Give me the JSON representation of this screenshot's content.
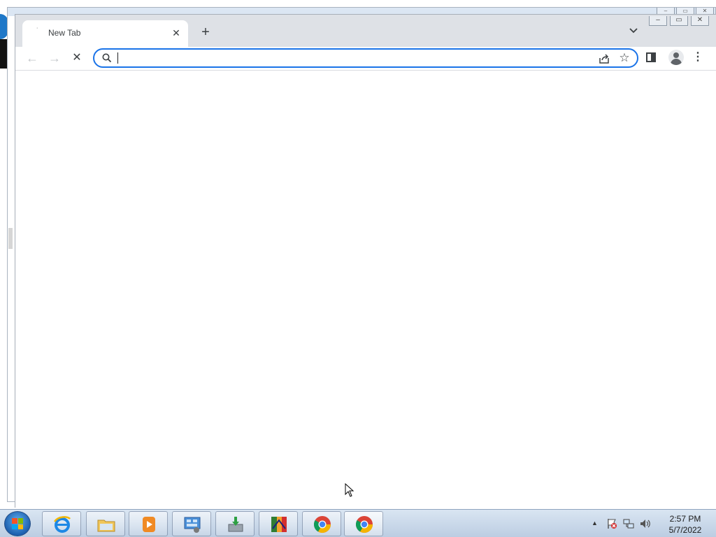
{
  "browser": {
    "tab": {
      "title": "New Tab",
      "favicon": "loading-dot",
      "close_label": "✕"
    },
    "new_tab_label": "+",
    "tab_search_label": "⌄",
    "window_controls": {
      "minimize": "–",
      "maximize": "▭",
      "close": "✕"
    },
    "toolbar": {
      "back_label": "←",
      "forward_label": "→",
      "stop_label": "✕",
      "star_label": "☆",
      "menu_label": "⋮"
    },
    "omnibox": {
      "value": "",
      "placeholder": ""
    }
  },
  "background_window": {
    "controls": {
      "minimize": "–",
      "maximize": "▭",
      "close": "✕"
    }
  },
  "taskbar": {
    "apps": [
      {
        "name": "Internet Explorer",
        "icon": "ie-icon"
      },
      {
        "name": "Windows Explorer",
        "icon": "folder-icon"
      },
      {
        "name": "Windows Media Player",
        "icon": "media-player-icon"
      },
      {
        "name": "Control Panel",
        "icon": "control-panel-icon"
      },
      {
        "name": "Installer",
        "icon": "installer-icon"
      },
      {
        "name": "AVG",
        "icon": "avg-icon"
      },
      {
        "name": "Google Chrome",
        "icon": "chrome-icon"
      },
      {
        "name": "Google Chrome",
        "icon": "chrome-icon"
      }
    ],
    "tray": {
      "show_hidden_label": "▲",
      "icons": [
        "action-center-icon",
        "network-icon",
        "volume-icon"
      ]
    },
    "clock": {
      "time": "2:57 PM",
      "date": "5/7/2022"
    }
  },
  "colors": {
    "accent": "#1a73e8",
    "tabstrip": "#dee1e6",
    "taskbar": "#c9d8ea"
  }
}
